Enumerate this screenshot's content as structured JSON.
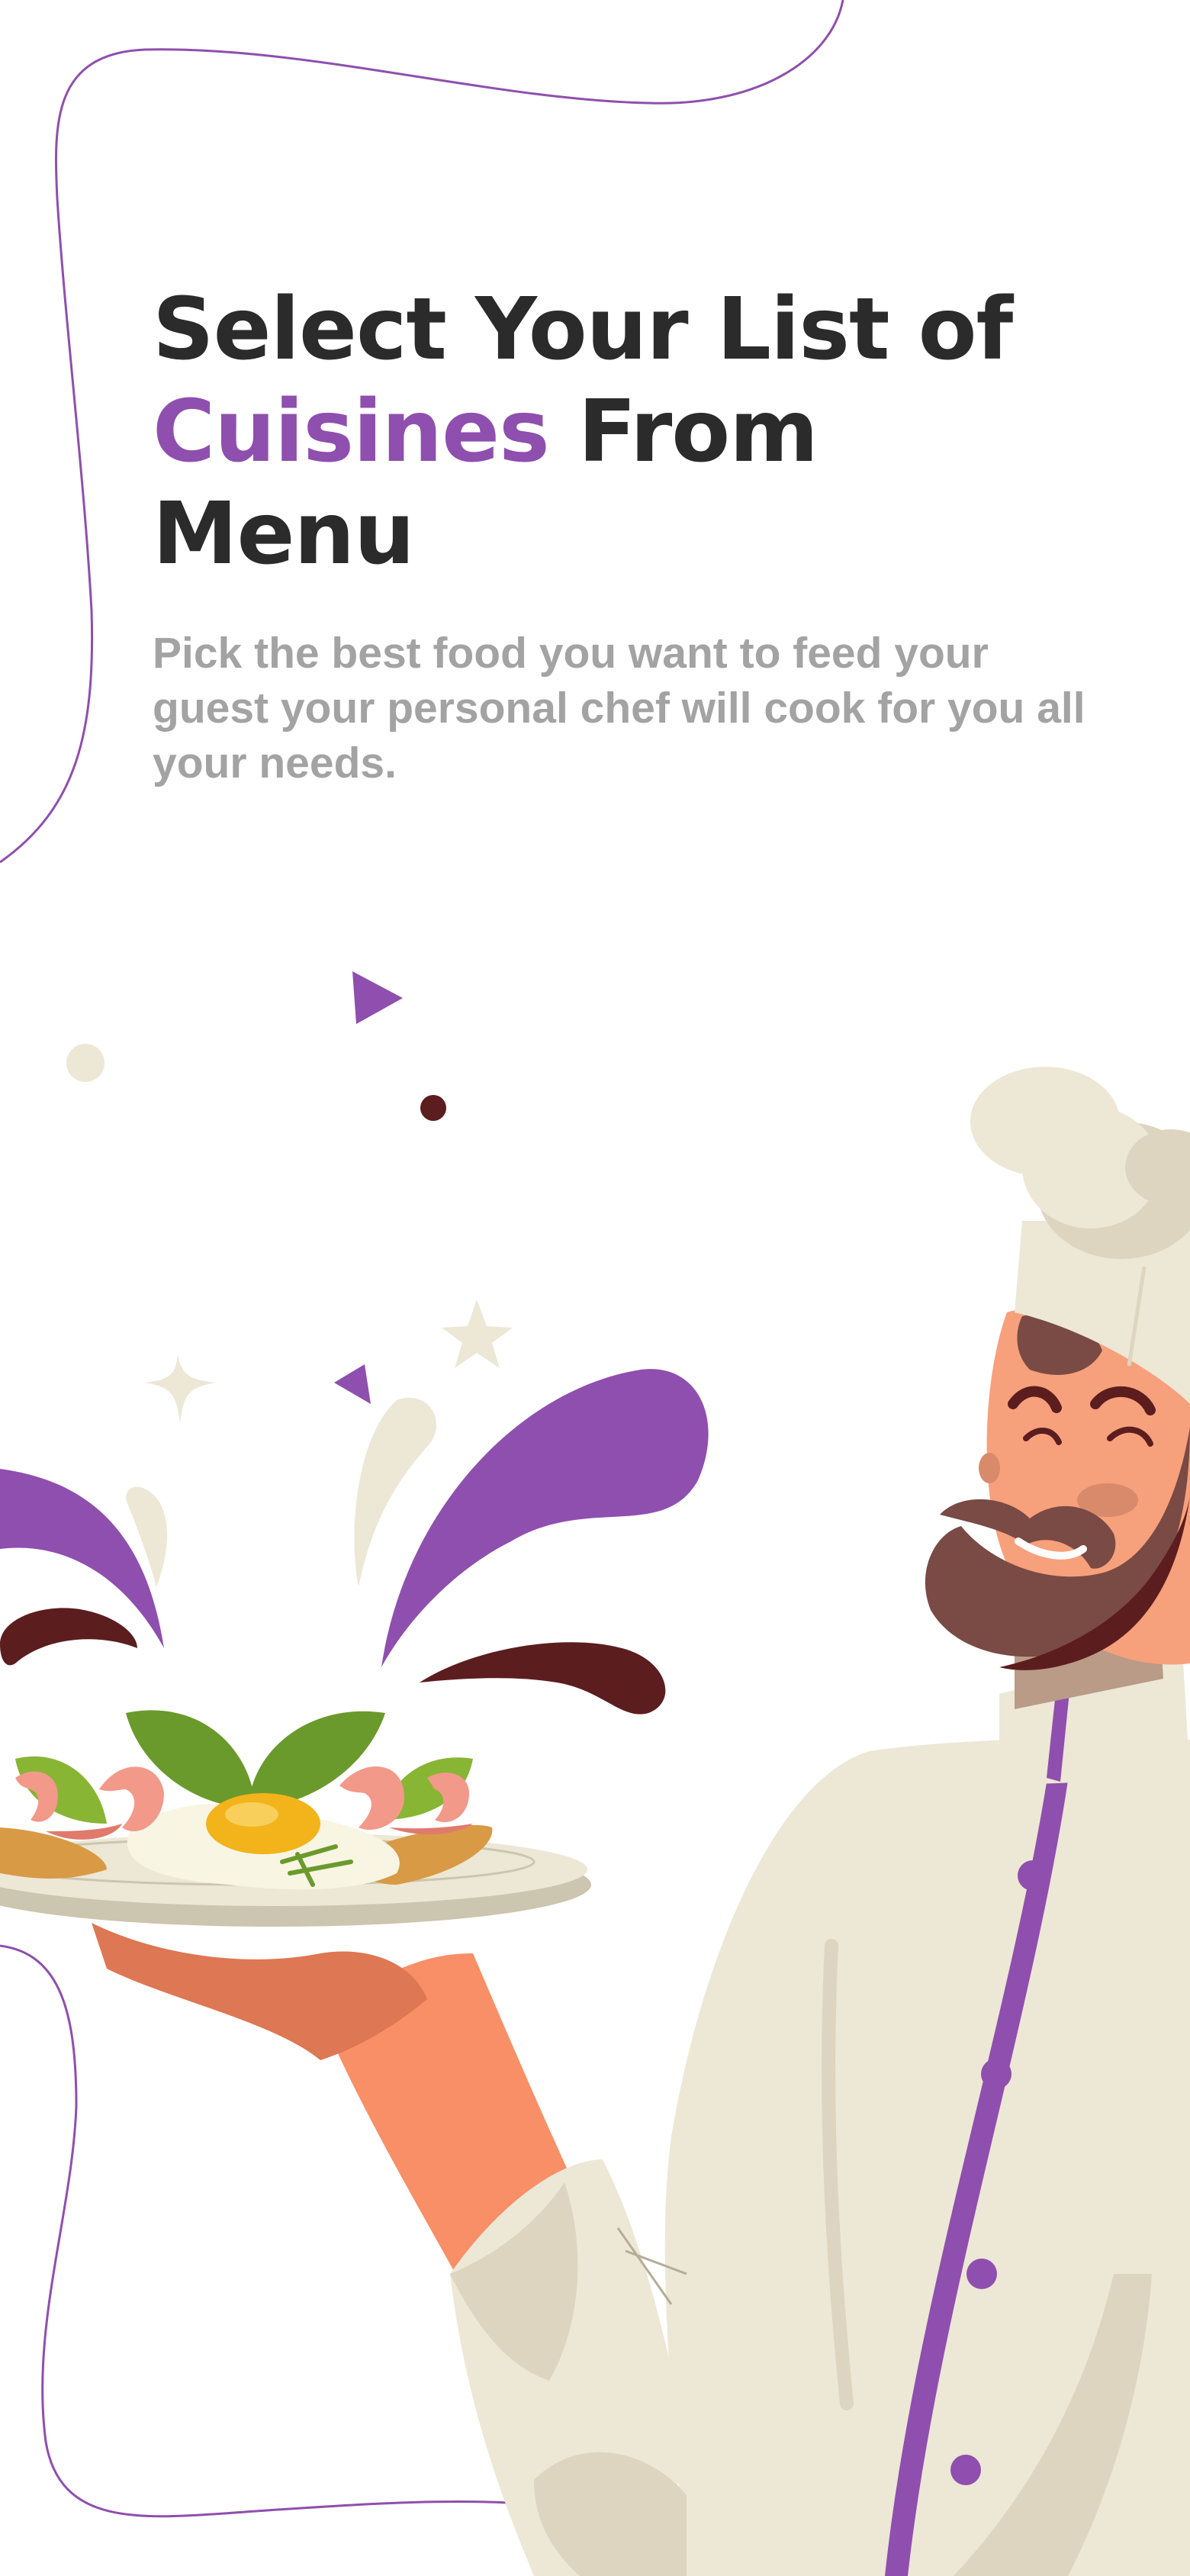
{
  "headline": {
    "line1": "Select Your List of",
    "line2_accent": "Cuisines",
    "line2_rest": " From",
    "line3": "Menu"
  },
  "subtitle": "Pick the best food you want to feed your guest your personal chef will cook for you all your needs.",
  "illustration": {
    "subject": "chef-holding-plate",
    "icons": [
      "chef-illustration-icon",
      "food-plate-icon",
      "fried-egg-icon",
      "shrimp-icon",
      "splash-icon",
      "star-icon",
      "sparkle-icon",
      "triangle-confetti-icon",
      "dot-confetti-icon"
    ]
  },
  "colors": {
    "accent": "#8f4fae",
    "heading": "#2b2b2b",
    "subtitle": "#a3a3a3",
    "cream": "#ede7d6",
    "skin": "#f7a07c",
    "maroon": "#5c1d1f"
  }
}
